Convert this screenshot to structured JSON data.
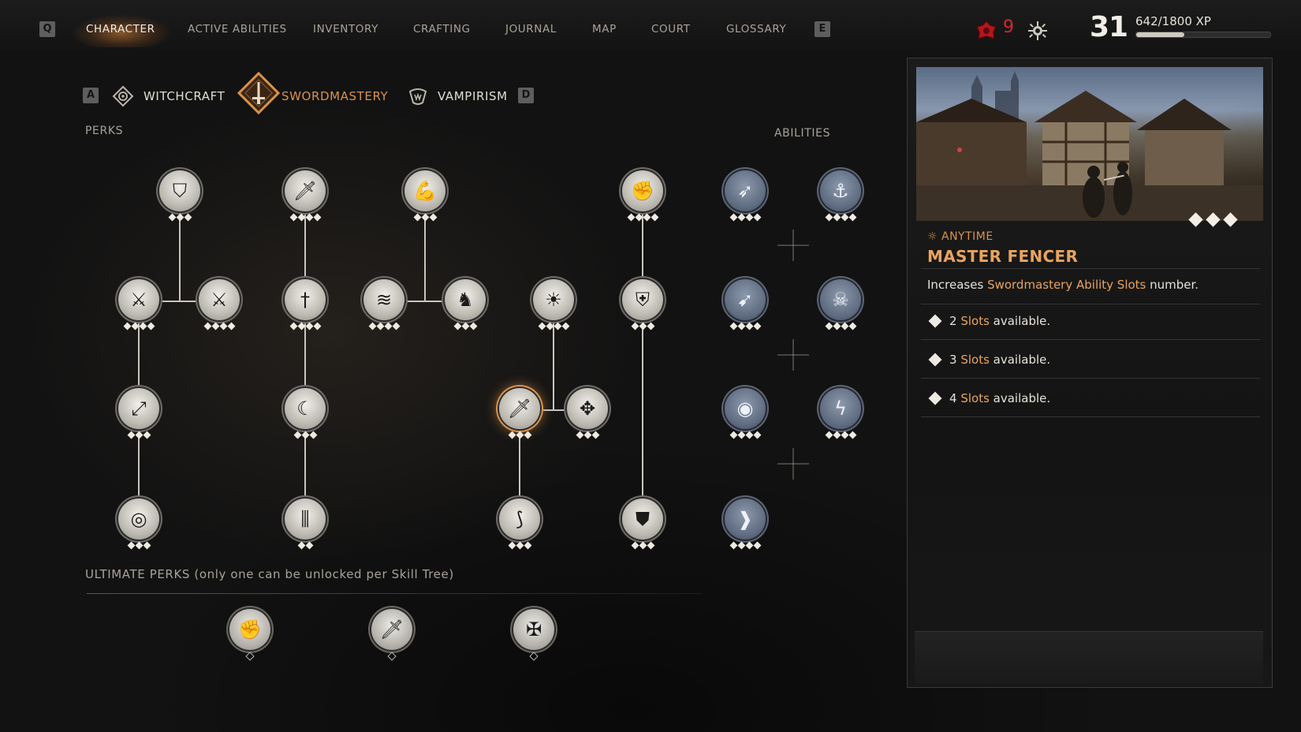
{
  "nav": {
    "left_key": "Q",
    "right_key": "E",
    "tabs": [
      "CHARACTER",
      "ACTIVE ABILITIES",
      "INVENTORY",
      "CRAFTING",
      "JOURNAL",
      "MAP",
      "COURT",
      "GLOSSARY"
    ],
    "active_tab": "CHARACTER"
  },
  "hud": {
    "blood_count": "9",
    "level": "31",
    "xp_text": "642/1800 XP",
    "xp_fraction": 0.357,
    "blood_icon": "blood-drop-icon",
    "settings_icon": "sun-gear-icon"
  },
  "skill_tabs": {
    "left_key": "A",
    "right_key": "D",
    "items": [
      {
        "label": "WITCHCRAFT",
        "icon": "witchcraft-icon"
      },
      {
        "label": "SWORDMASTERY",
        "icon": "swordmastery-icon",
        "active": true
      },
      {
        "label": "VAMPIRISM",
        "icon": "vampirism-icon"
      }
    ]
  },
  "sections": {
    "perks": "PERKS",
    "abilities": "ABILITIES",
    "ultimate": "ULTIMATE PERKS (only one can be unlocked per Skill Tree)"
  },
  "perks": [
    {
      "id": "p1",
      "icon": "shield-icon",
      "glyph": "⛉",
      "pips": 3
    },
    {
      "id": "p2",
      "icon": "dagger-strike-icon",
      "glyph": "🗡",
      "pips": 4
    },
    {
      "id": "p3",
      "icon": "flexed-arm-icon",
      "glyph": "💪",
      "pips": 3
    },
    {
      "id": "p4",
      "icon": "raised-fist-icon",
      "glyph": "✊",
      "pips": 4
    },
    {
      "id": "p5",
      "icon": "broken-blade-icon",
      "glyph": "⚔",
      "pips": 4
    },
    {
      "id": "p6",
      "icon": "crossed-swords-icon",
      "glyph": "⚔",
      "pips": 4
    },
    {
      "id": "p7",
      "icon": "sword-impact-icon",
      "glyph": "†",
      "pips": 4
    },
    {
      "id": "p8",
      "icon": "claw-slash-icon",
      "glyph": "≋",
      "pips": 4
    },
    {
      "id": "p9",
      "icon": "horse-icon",
      "glyph": "♞",
      "pips": 3
    },
    {
      "id": "p10",
      "icon": "flaming-mask-icon",
      "glyph": "☀",
      "pips": 4
    },
    {
      "id": "p11",
      "icon": "coat-armor-icon",
      "glyph": "⛨",
      "pips": 3
    },
    {
      "id": "p12",
      "icon": "parry-sword-icon",
      "glyph": "⤢",
      "pips": 3
    },
    {
      "id": "p13",
      "icon": "bleeding-cut-icon",
      "glyph": "☾",
      "pips": 3
    },
    {
      "id": "p14",
      "icon": "master-fencer-icon",
      "glyph": "🗡",
      "pips": 3,
      "selected": true
    },
    {
      "id": "p15",
      "icon": "target-crosshair-icon",
      "glyph": "✥",
      "pips": 3
    },
    {
      "id": "p16",
      "icon": "bullseye-icon",
      "glyph": "◎",
      "pips": 3
    },
    {
      "id": "p17",
      "icon": "twin-blades-icon",
      "glyph": "⫼",
      "pips": 2
    },
    {
      "id": "p18",
      "icon": "sword-swing-icon",
      "glyph": "⟆",
      "pips": 3
    },
    {
      "id": "p19",
      "icon": "plate-armor-icon",
      "glyph": "⛊",
      "pips": 3
    }
  ],
  "abilities": [
    {
      "id": "a1",
      "icon": "wing-dash-icon",
      "glyph": "➶",
      "pips": 4
    },
    {
      "id": "a2",
      "icon": "hook-slash-icon",
      "glyph": "⚓",
      "pips": 4
    },
    {
      "id": "a3",
      "icon": "bird-strike-icon",
      "glyph": "➹",
      "pips": 4
    },
    {
      "id": "a4",
      "icon": "skull-charge-icon",
      "glyph": "☠",
      "pips": 4
    },
    {
      "id": "a5",
      "icon": "vortex-icon",
      "glyph": "◉",
      "pips": 4
    },
    {
      "id": "a6",
      "icon": "serpent-rune-icon",
      "glyph": "ϟ",
      "pips": 4
    },
    {
      "id": "a7",
      "icon": "kick-icon",
      "glyph": "❱",
      "pips": 4
    }
  ],
  "ultimates": [
    {
      "id": "u1",
      "icon": "fist-ultimate-icon",
      "glyph": "✊"
    },
    {
      "id": "u2",
      "icon": "hand-sword-ultimate-icon",
      "glyph": "🗡"
    },
    {
      "id": "u3",
      "icon": "crossed-blade-ultimate-icon",
      "glyph": "✠"
    }
  ],
  "detail": {
    "image_label": "town-square-battle-image",
    "image_pips": 3,
    "tag_icon": "sun-moon-icon",
    "tag": "ANYTIME",
    "title": "MASTER FENCER",
    "desc_pre": "Increases ",
    "desc_hl": "Swordmastery Ability Slots",
    "desc_post": " number.",
    "ranks": [
      {
        "num": "2",
        "hl": "Slots",
        "rest": " available."
      },
      {
        "num": "3",
        "hl": "Slots",
        "rest": " available."
      },
      {
        "num": "4",
        "hl": "Slots",
        "rest": " available."
      }
    ]
  },
  "colors": {
    "accent": "#d9924a",
    "title": "#e8a45d",
    "blood": "#d8262c",
    "ability": "#5e6b80"
  }
}
